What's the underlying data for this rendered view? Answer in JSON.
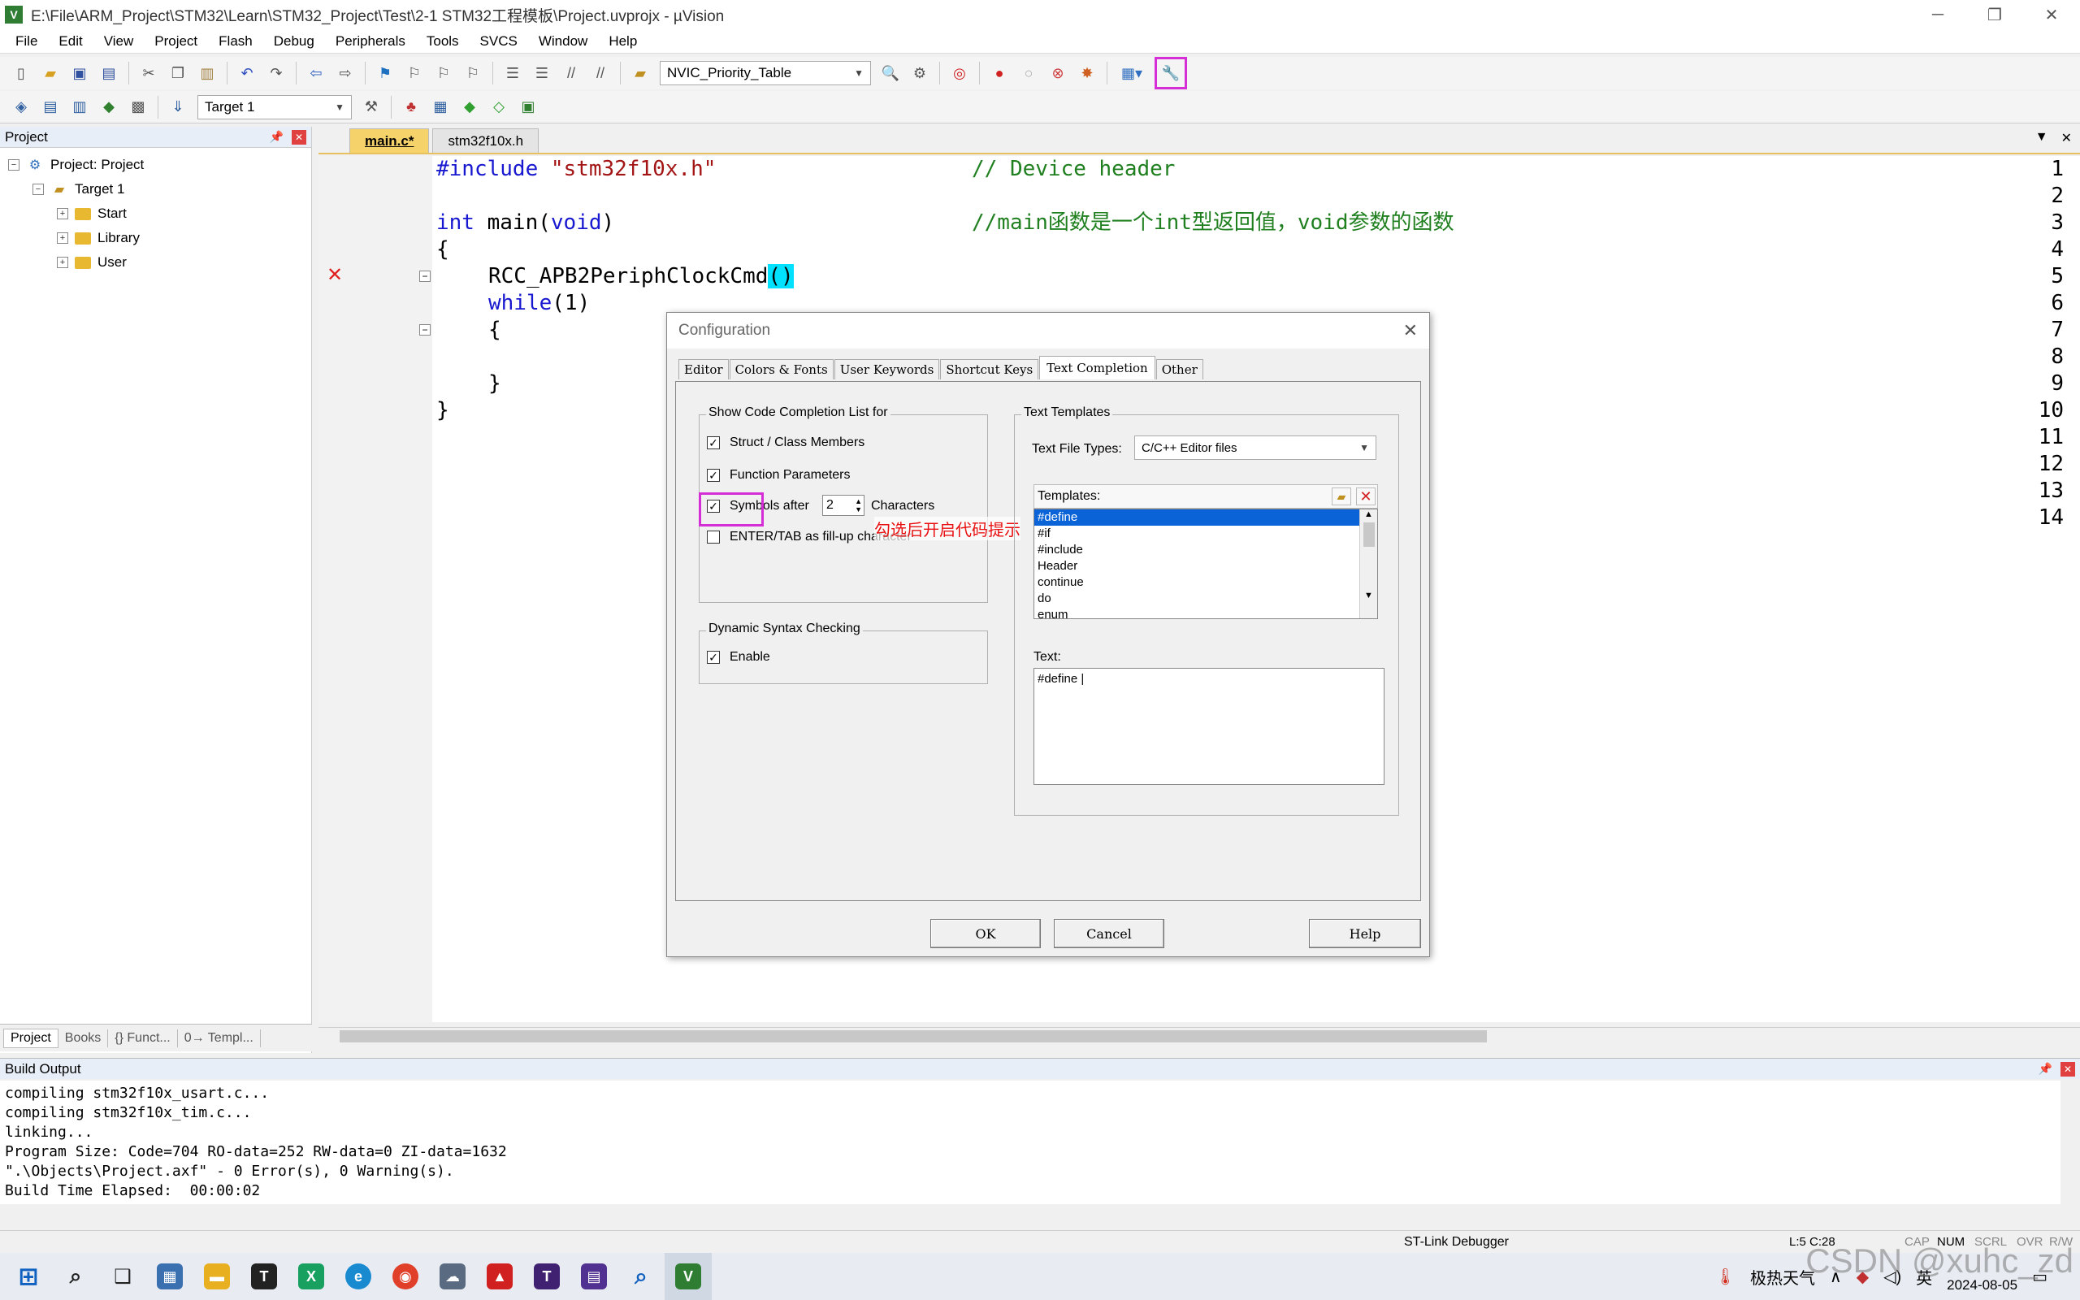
{
  "window": {
    "title": "E:\\File\\ARM_Project\\STM32\\Learn\\STM32_Project\\Test\\2-1 STM32工程模板\\Project.uvprojx - µVision",
    "controls": [
      "─",
      "❐",
      "✕"
    ]
  },
  "menu": [
    "File",
    "Edit",
    "View",
    "Project",
    "Flash",
    "Debug",
    "Peripherals",
    "Tools",
    "SVCS",
    "Window",
    "Help"
  ],
  "toolbar": {
    "find_combo": "NVIC_Priority_Table",
    "target_combo": "Target 1"
  },
  "project_panel": {
    "title": "Project",
    "tree": [
      {
        "label": "Project: Project",
        "level": 0,
        "expander": "−"
      },
      {
        "label": "Target 1",
        "level": 1,
        "expander": "−"
      },
      {
        "label": "Start",
        "level": 2,
        "expander": "+"
      },
      {
        "label": "Library",
        "level": 2,
        "expander": "+"
      },
      {
        "label": "User",
        "level": 2,
        "expander": "+"
      }
    ],
    "tabs": [
      "Project",
      "Books",
      "{} Funct...",
      "0→ Templ..."
    ]
  },
  "editor": {
    "tabs": [
      "main.c*",
      "stm32f10x.h"
    ],
    "line_numbers": [
      "1",
      "2",
      "3",
      "4",
      "5",
      "6",
      "7",
      "8",
      "9",
      "10",
      "11",
      "12",
      "13",
      "14"
    ],
    "line1_kw": "#include",
    "line1_str": "\"stm32f10x.h\"",
    "line1_cm": "// Device header",
    "line3_kw": "int",
    "line3_name": " main(",
    "line3_kw2": "void",
    "line3_end": ")",
    "line3_cm": "//main函数是一个int型返回值，void参数的函数",
    "line4": "{",
    "line5": "RCC_APB2PeriphClockCmd",
    "line5_paren": "()",
    "line6_kw": "while",
    "line6_rest": "(1)",
    "line7": "{",
    "line9": "}",
    "line10": "}",
    "error_mark": "✕"
  },
  "build_output": {
    "title": "Build Output",
    "lines": "compiling stm32f10x_usart.c...\ncompiling stm32f10x_tim.c...\nlinking...\nProgram Size: Code=704 RO-data=252 RW-data=0 ZI-data=1632\n\".\\Objects\\Project.axf\" - 0 Error(s), 0 Warning(s).\nBuild Time Elapsed:  00:00:02"
  },
  "status": {
    "debugger": "ST-Link Debugger",
    "position": "L:5 C:28",
    "indicators": [
      "CAP",
      "NUM",
      "SCRL",
      "OVR",
      "R/W"
    ]
  },
  "dialog": {
    "title": "Configuration",
    "tabs": [
      "Editor",
      "Colors & Fonts",
      "User Keywords",
      "Shortcut Keys",
      "Text Completion",
      "Other"
    ],
    "code_completion": {
      "group": "Show Code Completion List for",
      "struct": "Struct / Class Members",
      "func": "Function Parameters",
      "symbols": "Symbols after",
      "symbols_count": "2",
      "characters": "Characters",
      "enter_tab": "ENTER/TAB as fill-up character"
    },
    "syntax": {
      "group": "Dynamic Syntax Checking",
      "enable": "Enable"
    },
    "templates": {
      "group": "Text Templates",
      "file_types_label": "Text File Types:",
      "file_types_value": "C/C++ Editor files",
      "templates_label": "Templates:",
      "items": [
        "#define",
        "#if",
        "#include",
        "Header",
        "continue",
        "do",
        "enum"
      ],
      "text_label": "Text:",
      "text_value": "#define |"
    },
    "buttons": {
      "ok": "OK",
      "cancel": "Cancel",
      "help": "Help"
    },
    "annotation": "勾选后开启代码提示"
  },
  "taskbar": {
    "weather": "极热天气",
    "ime": "英",
    "date": "2024-08-05"
  },
  "watermark": "CSDN @xuhc_zd",
  "colors": {
    "highlight": "#d62ed6",
    "selection": "#0a64d8",
    "keyword": "#1818d0",
    "comment": "#208020",
    "string": "#a31515"
  }
}
